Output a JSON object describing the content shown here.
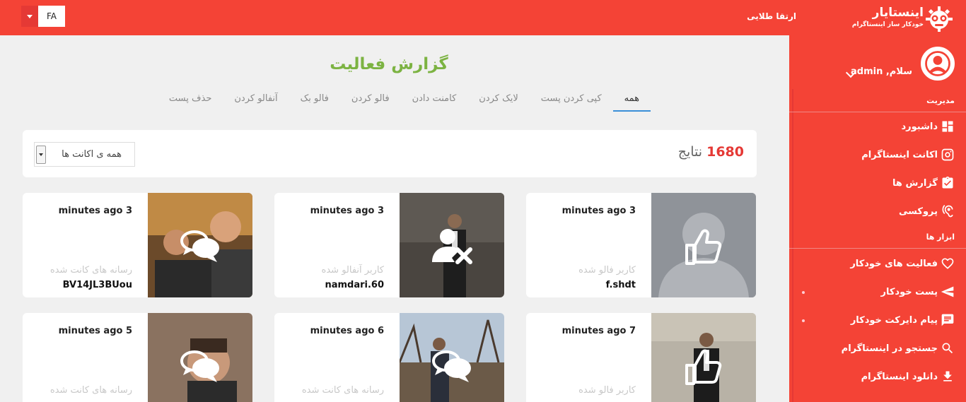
{
  "topbar": {
    "language": "FA",
    "upgrade_label": "ارتقا طلایی",
    "brand_name": "اینستایار",
    "brand_tagline": "خودکار ساز اینستاگرام",
    "colors": {
      "primary": "#f44336"
    }
  },
  "sidebar": {
    "greeting": "سلام, admin",
    "sections": [
      {
        "title": "مدیریت"
      },
      {
        "title": "ابزار ها"
      }
    ],
    "items": [
      {
        "label": "داشبورد",
        "icon": "dashboard-icon"
      },
      {
        "label": "اکانت اینستاگرام",
        "icon": "instagram-icon"
      },
      {
        "label": "گزارش ها",
        "icon": "report-check-icon"
      },
      {
        "label": "پروکسی",
        "icon": "proxy-ear-icon"
      },
      {
        "label": "فعالیت های خودکار",
        "icon": "heart-icon"
      },
      {
        "label": "پست خودکار",
        "icon": "send-icon"
      },
      {
        "label": "پیام دایرکت خودکار",
        "icon": "message-icon"
      },
      {
        "label": "جستجو در اینستاگرام",
        "icon": "search-icon"
      },
      {
        "label": "دانلود اینستاگرام",
        "icon": "download-icon"
      }
    ]
  },
  "main": {
    "title": "گزارش فعالیت",
    "tabs": [
      {
        "label": "همه",
        "active": true
      },
      {
        "label": "کپی کردن پست"
      },
      {
        "label": "لایک کردن"
      },
      {
        "label": "کامنت دادن"
      },
      {
        "label": "فالو کردن"
      },
      {
        "label": "فالو بک"
      },
      {
        "label": "آنفالو کردن"
      },
      {
        "label": "حذف پست"
      }
    ],
    "result_count": "1680",
    "result_label": "نتایج",
    "account_filter": "همه ی اکانت ها"
  },
  "cards": [
    {
      "time": "minutes ago 3",
      "type": "کاربر فالو شده",
      "target": "f.shdt",
      "action_icon": "thumbs-up-icon"
    },
    {
      "time": "minutes ago 3",
      "type": "کاربر آنفالو شده",
      "target": "namdari.60",
      "action_icon": "user-remove-icon"
    },
    {
      "time": "minutes ago 3",
      "type": "رسانه های کانت شده",
      "target": "BV14JL3BUou",
      "action_icon": "comments-icon"
    },
    {
      "time": "minutes ago 7",
      "type": "کاربر فالو شده",
      "target": "",
      "action_icon": "thumbs-up-icon"
    },
    {
      "time": "minutes ago 6",
      "type": "رسانه های کانت شده",
      "target": "",
      "action_icon": "comments-icon"
    },
    {
      "time": "minutes ago 5",
      "type": "رسانه های کانت شده",
      "target": "",
      "action_icon": "comments-icon"
    }
  ]
}
